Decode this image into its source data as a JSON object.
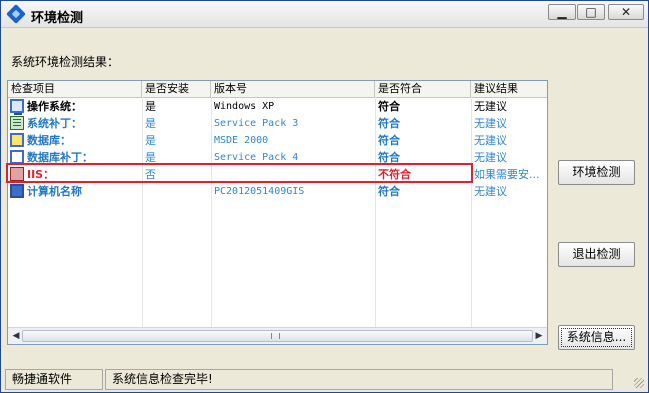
{
  "window": {
    "title": "环境检测",
    "controls": {
      "minimize": "▁",
      "maximize": "□",
      "close": "✕"
    }
  },
  "section_label": "系统环境检测结果：",
  "table": {
    "columns": [
      "检查项目",
      "是否安装",
      "版本号",
      "是否符合",
      "建议结果"
    ],
    "rows": [
      {
        "icon": "computer-icon",
        "item": "操作系统：",
        "installed": "是",
        "version": "Windows XP",
        "match": "符合",
        "advice": "无建议",
        "item_color": "#000000",
        "text_color": "#000000",
        "match_color": "#000000"
      },
      {
        "icon": "patch-icon",
        "item": "系统补丁：",
        "installed": "是",
        "version": "Service Pack 3",
        "match": "符合",
        "advice": "无建议",
        "item_color": "#1f78c8",
        "text_color": "#2d86d8",
        "match_color": "#1f78c8"
      },
      {
        "icon": "database-icon",
        "item": "数据库：",
        "installed": "是",
        "version": "MSDE 2000",
        "match": "符合",
        "advice": "无建议",
        "item_color": "#1f78c8",
        "text_color": "#2d86d8",
        "match_color": "#1f78c8"
      },
      {
        "icon": "database-patch-icon",
        "item": "数据库补丁：",
        "installed": "是",
        "version": "Service Pack 4",
        "match": "符合",
        "advice": "无建议",
        "item_color": "#1f78c8",
        "text_color": "#2d86d8",
        "match_color": "#1f78c8"
      },
      {
        "icon": "iis-icon",
        "item": "IIS：",
        "installed": "否",
        "version": "",
        "match": "不符合",
        "advice": "如果需要安...",
        "item_color": "#e5202e",
        "text_color": "#2d86d8",
        "match_color": "#e5202e"
      },
      {
        "icon": "computer-name-icon",
        "item": "计算机名称",
        "installed": "",
        "version": "PC2012051409GIS",
        "match": "符合",
        "advice": "无建议",
        "item_color": "#1f78c8",
        "text_color": "#2d86d8",
        "match_color": "#1f78c8"
      }
    ]
  },
  "scrollbar": {
    "left_arrow": "◀",
    "right_arrow": "▶"
  },
  "buttons": {
    "check": "环境检测",
    "exit": "退出检测",
    "info": "系统信息..."
  },
  "status": {
    "left": "畅捷通软件",
    "right": "系统信息检查完毕!"
  }
}
